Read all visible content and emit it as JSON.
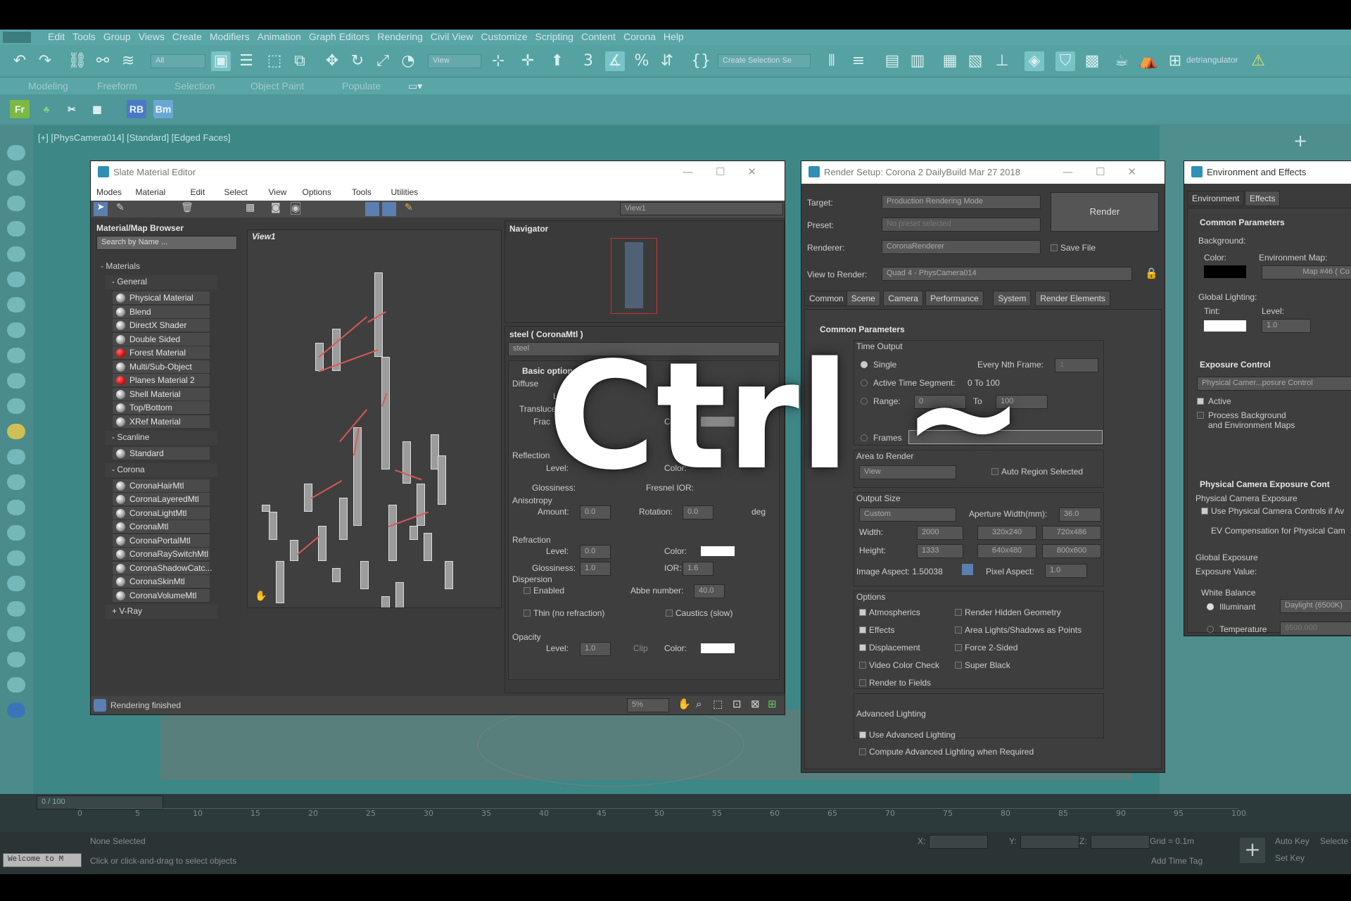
{
  "menu": [
    "Edit",
    "Tools",
    "Group",
    "Views",
    "Create",
    "Modifiers",
    "Animation",
    "Graph Editors",
    "Rendering",
    "Civil View",
    "Customize",
    "Scripting",
    "Content",
    "Corona",
    "Help"
  ],
  "toolbar": {
    "filter_all": "All",
    "view_dropdown": "View",
    "selection_set": "Create Selection Se",
    "detriangulator": "detriangulator"
  },
  "ribbon_tabs": [
    "Modeling",
    "Freeform",
    "Selection",
    "Object Paint",
    "Populate"
  ],
  "ribbon_icons": {
    "fr": "Fr",
    "rb": "RB",
    "bm": "Bm"
  },
  "viewport_label": "[+] [PhysCamera014] [Standard] [Edged Faces]",
  "slate": {
    "title": "Slate Material Editor",
    "menu": [
      "Modes",
      "Material",
      "Edit",
      "Select",
      "View",
      "Options",
      "Tools",
      "Utilities"
    ],
    "view_dropdown": "View1",
    "browser_title": "Material/Map Browser",
    "search_placeholder": "Search by Name ...",
    "materials_header": "- Materials",
    "general_header": "- General",
    "general": [
      "Physical Material",
      "Blend",
      "DirectX Shader",
      "Double Sided",
      "Forest Material",
      "Multi/Sub-Object",
      "Planes Material 2",
      "Shell Material",
      "Top/Bottom",
      "XRef Material"
    ],
    "scanline_header": "- Scanline",
    "scanline": [
      "Standard"
    ],
    "corona_header": "- Corona",
    "corona": [
      "CoronaHairMtl",
      "CoronaLayeredMtl",
      "CoronaLightMtl",
      "CoronaMtl",
      "CoronaPortalMtl",
      "CoronaRaySwitchMtl",
      "CoronaShadowCatc...",
      "CoronaSkinMtl",
      "CoronaVolumeMtl"
    ],
    "vray_header": "+ V-Ray",
    "view_tab": "View1",
    "navigator": "Navigator",
    "props_title": "steel  ( CoronaMtl )",
    "props_name": "steel",
    "basic_options": "Basic options",
    "diffuse": "Diffuse",
    "level": "Level:",
    "translucency": "Transluce",
    "fraction": "Frac",
    "color": "Color:",
    "reflection": "Reflection",
    "glossiness": "Glossiness:",
    "fresnel": "Fresnel IOR:",
    "anisotropy": "Anisotropy",
    "amount": "Amount:",
    "amount_val": "0.0",
    "rotation": "Rotation:",
    "rotation_val": "0.0",
    "deg": "deg",
    "refraction": "Refraction",
    "refr_level": "0.0",
    "refr_gloss": "1.0",
    "ior": "IOR:",
    "ior_val": "1.6",
    "dispersion": "Dispersion",
    "enabled": "Enabled",
    "abbe": "Abbe number:",
    "abbe_val": "40.0",
    "thin": "Thin (no refraction)",
    "caustics": "Caustics (slow)",
    "opacity": "Opacity",
    "op_level": "1.0",
    "clip": "Clip",
    "status": "Rendering finished",
    "zoom": "5%"
  },
  "render_setup": {
    "title": "Render Setup: Corona 2 DailyBuild Mar 27 2018",
    "target_label": "Target:",
    "target": "Production Rendering Mode",
    "preset_label": "Preset:",
    "preset": "No preset selected",
    "renderer_label": "Renderer:",
    "renderer": "CoronaRenderer",
    "save_file": "Save File",
    "view_label": "View to Render:",
    "view": "Quad 4 - PhysCamera014",
    "render_button": "Render",
    "tabs": [
      "Common",
      "Scene",
      "Camera",
      "Performance",
      "System",
      "Render Elements"
    ],
    "common_params": "Common Parameters",
    "time_output": "Time Output",
    "single": "Single",
    "every_nth": "Every Nth Frame:",
    "every_nth_val": "1",
    "active_segment": "Active Time Segment:",
    "active_segment_val": "0 To 100",
    "range": "Range:",
    "range_from": "0",
    "to": "To",
    "range_to": "100",
    "frames": "Frames",
    "area_to_render": "Area to Render",
    "area_view": "View",
    "auto_region": "Auto Region Selected",
    "output_size": "Output Size",
    "custom": "Custom",
    "aperture": "Aperture Width(mm):",
    "aperture_val": "36.0",
    "width": "Width:",
    "width_val": "2000",
    "height": "Height:",
    "height_val": "1333",
    "presets": [
      "320x240",
      "720x486",
      "640x480",
      "800x600"
    ],
    "image_aspect": "Image Aspect: 1.50038",
    "pixel_aspect": "Pixel Aspect:",
    "pixel_aspect_val": "1.0",
    "options": "Options",
    "opt_left": [
      "Atmospherics",
      "Effects",
      "Displacement",
      "Video Color Check",
      "Render to Fields"
    ],
    "opt_right": [
      "Render Hidden Geometry",
      "Area Lights/Shadows as Points",
      "Force 2-Sided",
      "Super Black"
    ],
    "adv_lighting": "Advanced Lighting",
    "use_adv": "Use Advanced Lighting",
    "compute_adv": "Compute Advanced Lighting when Required"
  },
  "env_effects": {
    "title": "Environment and Effects",
    "tabs": [
      "Environment",
      "Effects"
    ],
    "common_params": "Common Parameters",
    "background": "Background:",
    "color": "Color:",
    "env_map": "Environment Map:",
    "map_name": "Map #46  ( Co",
    "global_lighting": "Global Lighting:",
    "tint": "Tint:",
    "level": "Level:",
    "level_val": "1.0",
    "exposure_control": "Exposure Control",
    "exposure_type": "Physical Camer...posure Control",
    "active": "Active",
    "process_bg": "Process Background",
    "process_bg2": "and Environment Maps",
    "phys_cam": "Physical Camera Exposure Cont",
    "phys_cam_exp": "Physical Camera Exposure",
    "use_phys": "Use Physical Camera Controls if Av",
    "ev_comp": "EV Compensation for Physical Cam",
    "global_exposure": "Global Exposure",
    "exposure_value": "Exposure Value:",
    "white_balance": "White Balance",
    "illuminant": "Illuminant",
    "daylight": "Daylight (6500K)",
    "temperature": "Temperature",
    "temp_val": "6500.000"
  },
  "timeline": {
    "frame_counter": "0 / 100",
    "ticks": [
      "0",
      "5",
      "10",
      "15",
      "20",
      "25",
      "30",
      "35",
      "40",
      "45",
      "50",
      "55",
      "60",
      "65",
      "70",
      "75",
      "80",
      "85",
      "90",
      "95",
      "100"
    ]
  },
  "status": {
    "selected": "None Selected",
    "hint": "Click or click-and-drag to select objects",
    "welcome": "Welcome to M",
    "x": "X:",
    "y": "Y:",
    "z": "Z:",
    "grid": "Grid = 0.1m",
    "add_time_tag": "Add Time Tag",
    "auto_key": "Auto Key",
    "set_key": "Set Key",
    "selected_btn": "Selecte"
  },
  "overlay_text": "Ctrl ~"
}
